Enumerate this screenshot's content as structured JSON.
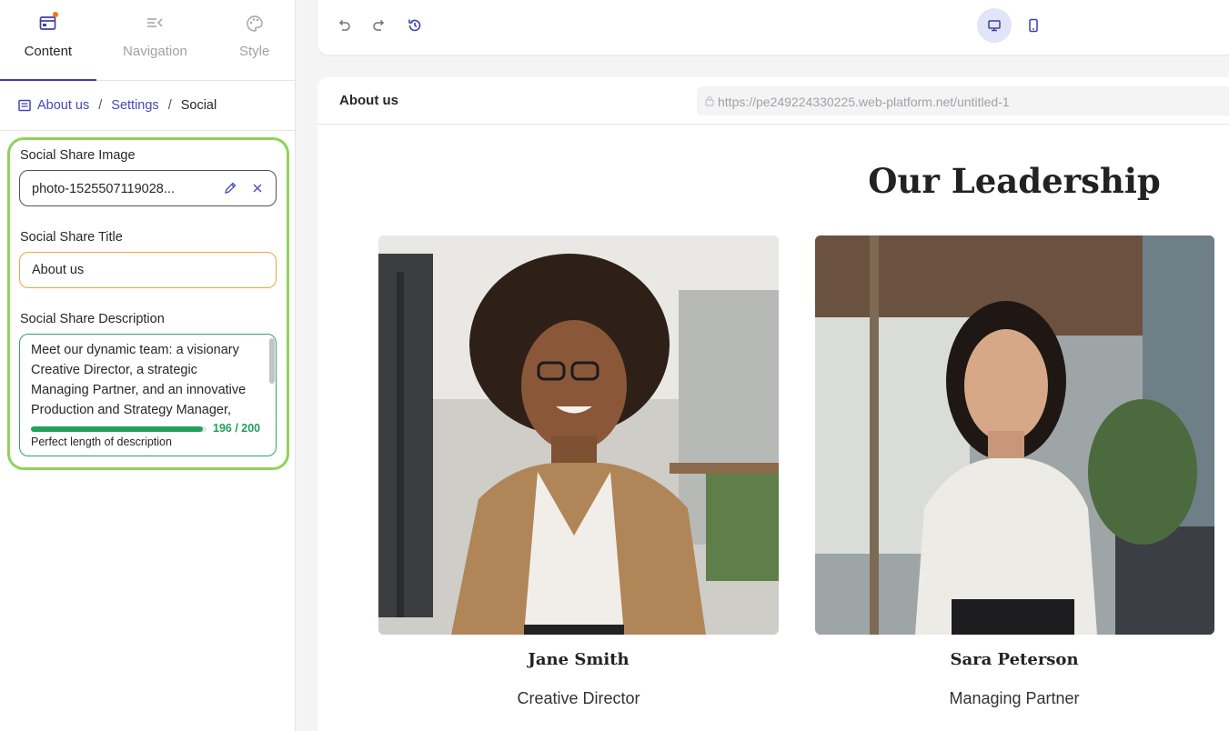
{
  "tabs": [
    {
      "label": "Content",
      "icon": "content-icon",
      "active": true
    },
    {
      "label": "Navigation",
      "icon": "navigation-icon",
      "active": false
    },
    {
      "label": "Style",
      "icon": "palette-icon",
      "active": false
    }
  ],
  "breadcrumb": {
    "items": [
      "About us",
      "Settings",
      "Social"
    ],
    "separator": "/"
  },
  "social": {
    "image_label": "Social Share Image",
    "image_value": "photo-1525507119028...",
    "title_label": "Social Share Title",
    "title_value": "About us",
    "description_label": "Social Share Description",
    "description_value": "Meet our dynamic team: a visionary Creative Director, a strategic Managing Partner, and an innovative Production and Strategy Manager,",
    "char_count": "196 / 200",
    "char_progress": 0.98,
    "hint": "Perfect length of description"
  },
  "preview": {
    "page_title": "About us",
    "url": "https://pe249224330225.web-platform.net/untitled-1",
    "heading": "Our Leadership",
    "people": [
      {
        "name": "Jane Smith",
        "role": "Creative Director"
      },
      {
        "name": "Sara Peterson",
        "role": "Managing Partner"
      }
    ]
  },
  "colors": {
    "accent": "#3f3fa8",
    "success": "#22a05c",
    "highlight": "#8ed35a",
    "warning_border": "#f0a63c"
  }
}
